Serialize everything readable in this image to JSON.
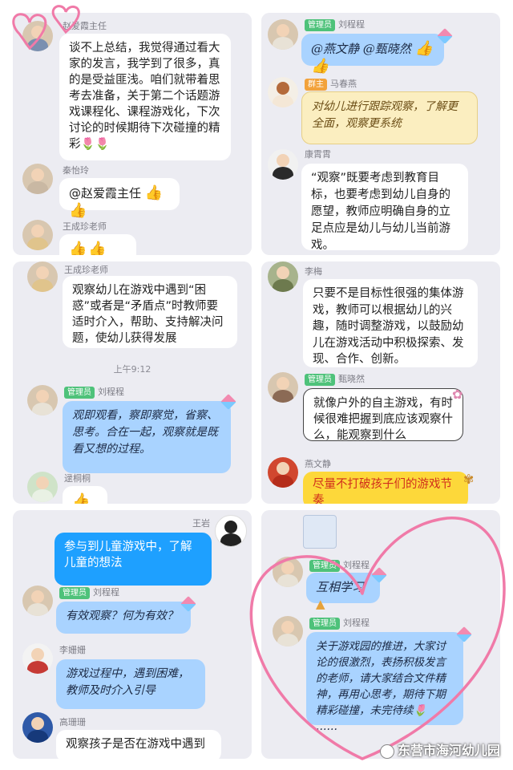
{
  "p1": {
    "m1": {
      "name": "赵爱霞主任",
      "text": "谈不上总结，我觉得通过看大家的发言，我学到了很多，真的是受益匪浅。咱们就带着思考去准备，关于第二个话题游戏课程化、课程游戏化，下次讨论的时候期待下次碰撞的精彩"
    },
    "m2": {
      "name": "秦怡玲",
      "text": "@赵爱霞主任",
      "thumbs": "👍👍"
    },
    "m3": {
      "name": "王成珍老师",
      "thumbs": "👍👍👍"
    }
  },
  "p2": {
    "m1": {
      "badge": "管理员",
      "name": "刘程程",
      "text": "@燕文静 @甄晓然",
      "thumbs": "👍👍"
    },
    "m2": {
      "badge": "群主",
      "name": "马春燕",
      "text": "对幼儿进行跟踪观察，了解更全面，观察更系统"
    },
    "m3": {
      "name": "康霄霄",
      "text": "“观察”既要考虑到教育目标，也要考虑到幼儿自身的愿望，教师应明确自身的立足点应是幼儿与幼儿当前游戏。"
    }
  },
  "p3": {
    "m1": {
      "name": "王成珍老师",
      "text": "观察幼儿在游戏中遇到“困惑”或者是“矛盾点”时教师要适时介入，帮助、支持解决问题，使幼儿获得发展"
    },
    "time": "上午9:12",
    "m2": {
      "badge": "管理员",
      "name": "刘程程",
      "text": "观即观看，察即察觉，省察、思考。合在一起，观察就是既看又想的过程。"
    },
    "m3": {
      "name": "逯桐桐",
      "thumbs": "👍"
    }
  },
  "p4": {
    "m1": {
      "name": "李梅",
      "text": "只要不是目标性很强的集体游戏，教师可以根据幼儿的兴趣，随时调整游戏，以鼓励幼儿在游戏活动中积极探索、发现、合作、创新。"
    },
    "m2": {
      "badge": "管理员",
      "name": "甄晓然",
      "text": "就像户外的自主游戏，有时候很难把握到底应该观察什么，能观察到什么"
    },
    "m3": {
      "name": "燕文静",
      "text": "尽量不打破孩子们的游戏节奏"
    }
  },
  "p5": {
    "sent": {
      "name": "王岩",
      "text": "参与到儿童游戏中，了解儿童的想法"
    },
    "m1": {
      "badge": "管理员",
      "name": "刘程程",
      "text": "有效观察？何为有效？"
    },
    "m2": {
      "name": "李姗姗",
      "text": "游戏过程中，遇到困难，教师及时介入引导"
    },
    "m3": {
      "name": "高珊珊",
      "text": "观察孩子是否在游戏中遇到"
    }
  },
  "p6": {
    "m1": {
      "badge": "管理员",
      "name": "刘程程",
      "text": "互相学习"
    },
    "m2": {
      "badge": "管理员",
      "name": "刘程程",
      "text": "关于游戏园的推进，大家讨论的很激烈，表扬积极发言的老师，请大家结合文件精神，再用心思考，期待下期精彩碰撞，未完待续"
    },
    "ellipsis": "……"
  },
  "watermark": "东营市海河幼儿园",
  "colors": {
    "heart": "#f07aa8",
    "sent_bubble": "#1ea0ff",
    "blue_bubble": "#a9d3ff"
  }
}
